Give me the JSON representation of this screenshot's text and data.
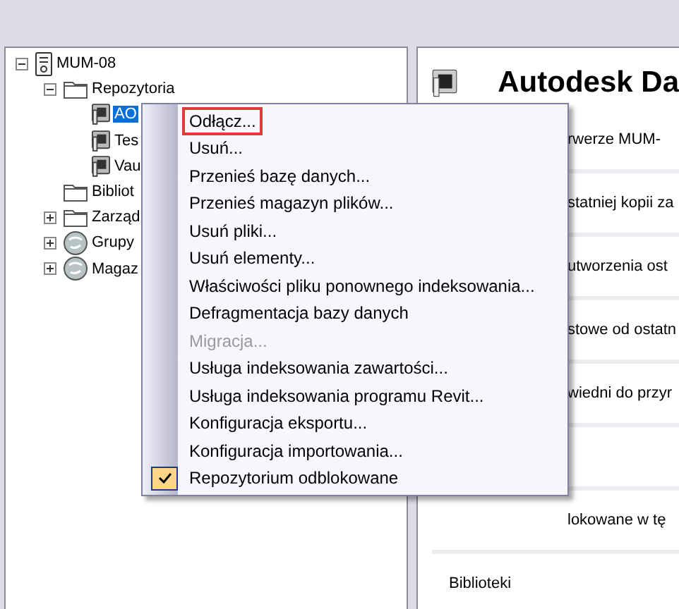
{
  "tree": [
    {
      "label": "MUM-08",
      "kind": "server",
      "expanded": true,
      "selected": false,
      "children": [
        {
          "label": "Repozytoria",
          "kind": "folder",
          "expanded": true,
          "selected": false,
          "children": [
            {
              "label": "AO",
              "kind": "vault",
              "selected": true
            },
            {
              "label": "Tes",
              "kind": "vault",
              "selected": false
            },
            {
              "label": "Vau",
              "kind": "vault",
              "selected": false
            }
          ]
        },
        {
          "label": "Bibliot",
          "kind": "folder",
          "selected": false
        },
        {
          "label": "Zarząd",
          "kind": "folder",
          "expanded": false,
          "selected": false
        },
        {
          "label": "Grupy",
          "kind": "globe",
          "expanded": false,
          "selected": false
        },
        {
          "label": "Magaz",
          "kind": "globe",
          "expanded": false,
          "selected": false
        }
      ]
    }
  ],
  "details": {
    "title": "Autodesk Da",
    "rows": [
      {
        "text": "rwerze MUM-",
        "covered": true
      },
      {
        "text": "statniej kopii za",
        "covered": true
      },
      {
        "text": "utworzenia ost",
        "covered": true
      },
      {
        "text": "stowe od ostatn",
        "covered": true
      },
      {
        "text": "wiedni do przyr",
        "covered": true
      },
      {},
      {
        "text": "lokowane w tę",
        "covered": true
      },
      {
        "text": "Biblioteki",
        "covered": false
      }
    ]
  },
  "context_menu": [
    {
      "label": "Odłącz...",
      "outlined": true,
      "disabled": false,
      "checked": false
    },
    {
      "label": "Usuń...",
      "outlined": false,
      "disabled": false,
      "checked": false
    },
    {
      "label": "Przenieś bazę danych...",
      "outlined": false,
      "disabled": false,
      "checked": false
    },
    {
      "label": "Przenieś magazyn plików...",
      "outlined": false,
      "disabled": false,
      "checked": false
    },
    {
      "label": "Usuń pliki...",
      "outlined": false,
      "disabled": false,
      "checked": false
    },
    {
      "label": "Usuń elementy...",
      "outlined": false,
      "disabled": false,
      "checked": false
    },
    {
      "label": "Właściwości pliku ponownego indeksowania...",
      "outlined": false,
      "disabled": false,
      "checked": false
    },
    {
      "label": "Defragmentacja bazy danych",
      "outlined": false,
      "disabled": false,
      "checked": false
    },
    {
      "label": "Migracja...",
      "outlined": false,
      "disabled": true,
      "checked": false
    },
    {
      "label": "Usługa indeksowania zawartości...",
      "outlined": false,
      "disabled": false,
      "checked": false
    },
    {
      "label": "Usługa indeksowania programu Revit...",
      "outlined": false,
      "disabled": false,
      "checked": false
    },
    {
      "label": "Konfiguracja eksportu...",
      "outlined": false,
      "disabled": false,
      "checked": false
    },
    {
      "label": "Konfiguracja importowania...",
      "outlined": false,
      "disabled": false,
      "checked": false
    },
    {
      "label": "Repozytorium odblokowane",
      "outlined": false,
      "disabled": false,
      "checked": true
    }
  ]
}
